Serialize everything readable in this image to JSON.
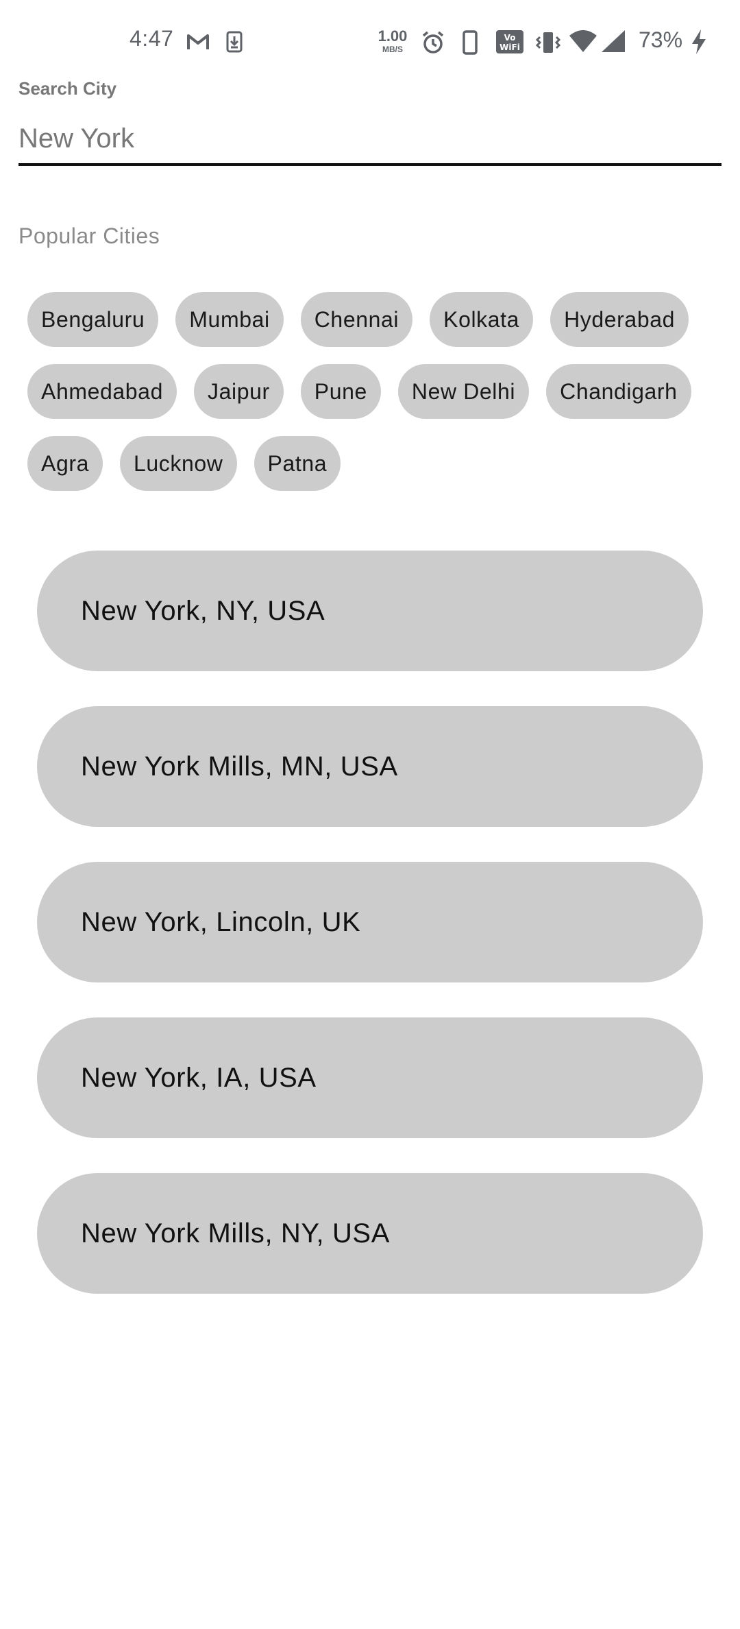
{
  "status_bar": {
    "time": "4:47",
    "network_speed_value": "1.00",
    "network_speed_unit": "MB/S",
    "battery_percent": "73%",
    "icons": [
      "gmail-icon",
      "download-icon",
      "alarm-icon",
      "phone-icon",
      "vowifi-icon",
      "vibrate-icon",
      "wifi-icon",
      "signal-icon",
      "charging-icon"
    ]
  },
  "search": {
    "label": "Search City",
    "value": "New York"
  },
  "popular": {
    "title": "Popular Cities",
    "cities": [
      "Bengaluru",
      "Mumbai",
      "Chennai",
      "Kolkata",
      "Hyderabad",
      "Ahmedabad",
      "Jaipur",
      "Pune",
      "New Delhi",
      "Chandigarh",
      "Agra",
      "Lucknow",
      "Patna"
    ]
  },
  "results": [
    "New York, NY, USA",
    "New York Mills, MN, USA",
    "New York, Lincoln, UK",
    "New York, IA, USA",
    "New York Mills, NY, USA"
  ],
  "colors": {
    "chip_bg": "#cccccc",
    "status_icon": "#5f6368",
    "input_underline": "#111111"
  }
}
